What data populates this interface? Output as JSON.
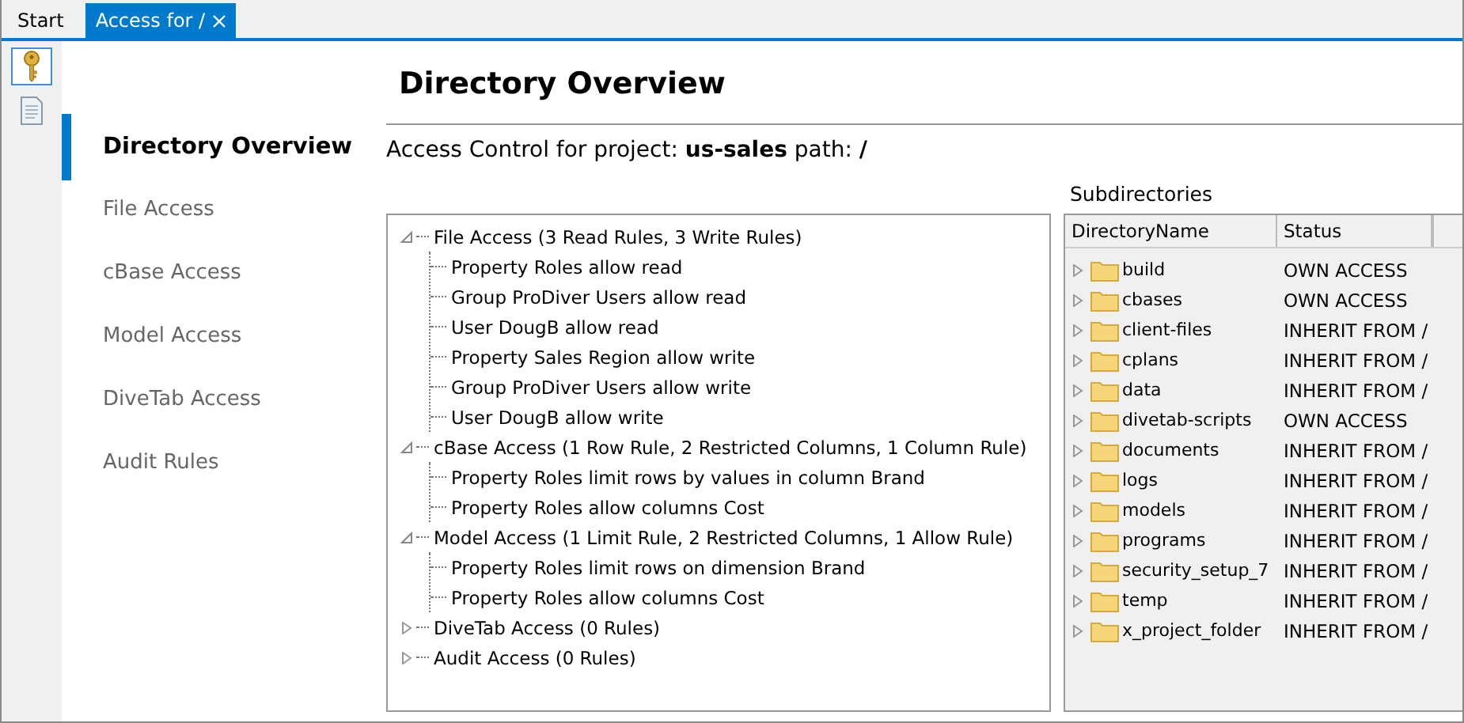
{
  "tabs": [
    {
      "label": "Start",
      "selected": false,
      "closable": false
    },
    {
      "label": "Access for /",
      "selected": true,
      "closable": true
    }
  ],
  "toolbar": [
    {
      "kind": "key",
      "selected": true
    },
    {
      "kind": "document",
      "selected": false
    }
  ],
  "nav": [
    {
      "label": "Directory Overview",
      "selected": true
    },
    {
      "label": "File Access",
      "selected": false
    },
    {
      "label": "cBase Access",
      "selected": false
    },
    {
      "label": "Model Access",
      "selected": false
    },
    {
      "label": "DiveTab Access",
      "selected": false
    },
    {
      "label": "Audit Rules",
      "selected": false
    }
  ],
  "heading": "Directory Overview",
  "subtitle": "Access Control for project: **us-sales** path: **/**",
  "rules_tree": [
    {
      "label": "File Access (3 Read Rules, 3 Write Rules)",
      "expanded": true,
      "children": [
        {
          "label": "Property Roles allow read"
        },
        {
          "label": "Group ProDiver Users allow read"
        },
        {
          "label": "User DougB allow read"
        },
        {
          "label": "Property Sales Region allow write"
        },
        {
          "label": "Group ProDiver Users allow write"
        },
        {
          "label": "User DougB allow write"
        }
      ]
    },
    {
      "label": "cBase Access (1 Row Rule, 2 Restricted Columns, 1 Column Rule)",
      "expanded": true,
      "children": [
        {
          "label": "Property Roles limit rows by values in column Brand"
        },
        {
          "label": "Property Roles allow columns Cost"
        }
      ]
    },
    {
      "label": "Model Access (1 Limit Rule, 2 Restricted Columns, 1 Allow Rule)",
      "expanded": true,
      "children": [
        {
          "label": "Property Roles limit rows on dimension Brand"
        },
        {
          "label": "Property Roles allow columns Cost"
        }
      ]
    },
    {
      "label": "DiveTab Access (0 Rules)",
      "expanded": false
    },
    {
      "label": "Audit Access (0 Rules)",
      "expanded": false
    }
  ],
  "subdirectories": {
    "title": "Subdirectories",
    "columns": [
      "DirectoryName",
      "Status"
    ],
    "rows": [
      {
        "name": "build",
        "status": "OWN ACCESS"
      },
      {
        "name": "cbases",
        "status": "OWN ACCESS"
      },
      {
        "name": "client-files",
        "status": "INHERIT FROM /"
      },
      {
        "name": "cplans",
        "status": "INHERIT FROM /"
      },
      {
        "name": "data",
        "status": "INHERIT FROM /"
      },
      {
        "name": "divetab-scripts",
        "status": "OWN ACCESS"
      },
      {
        "name": "documents",
        "status": "INHERIT FROM /"
      },
      {
        "name": "logs",
        "status": "INHERIT FROM /"
      },
      {
        "name": "models",
        "status": "INHERIT FROM /"
      },
      {
        "name": "programs",
        "status": "INHERIT FROM /"
      },
      {
        "name": "security_setup_7",
        "status": "INHERIT FROM /"
      },
      {
        "name": "temp",
        "status": "INHERIT FROM /"
      },
      {
        "name": "x_project_folder",
        "status": "INHERIT FROM /"
      }
    ]
  }
}
